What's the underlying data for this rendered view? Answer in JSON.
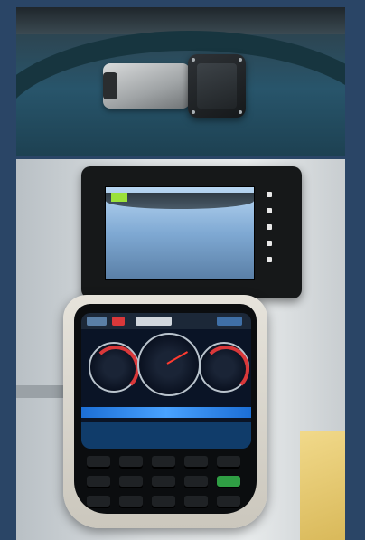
{
  "colors": {
    "background": "#2a4566",
    "monitor_housing": "#161819",
    "camera_view_sky": "#7fa9d3",
    "cluster_screen": "#0a1426",
    "cluster_accent_blue": "#49a2ff",
    "gauge_redline": "#d9383a",
    "status_green": "#9be13a"
  },
  "icons": [
    "camera-unit-icon",
    "radar-sensor-icon",
    "display-monitor-icon",
    "gauge-cluster-icon",
    "keypad-icon"
  ]
}
